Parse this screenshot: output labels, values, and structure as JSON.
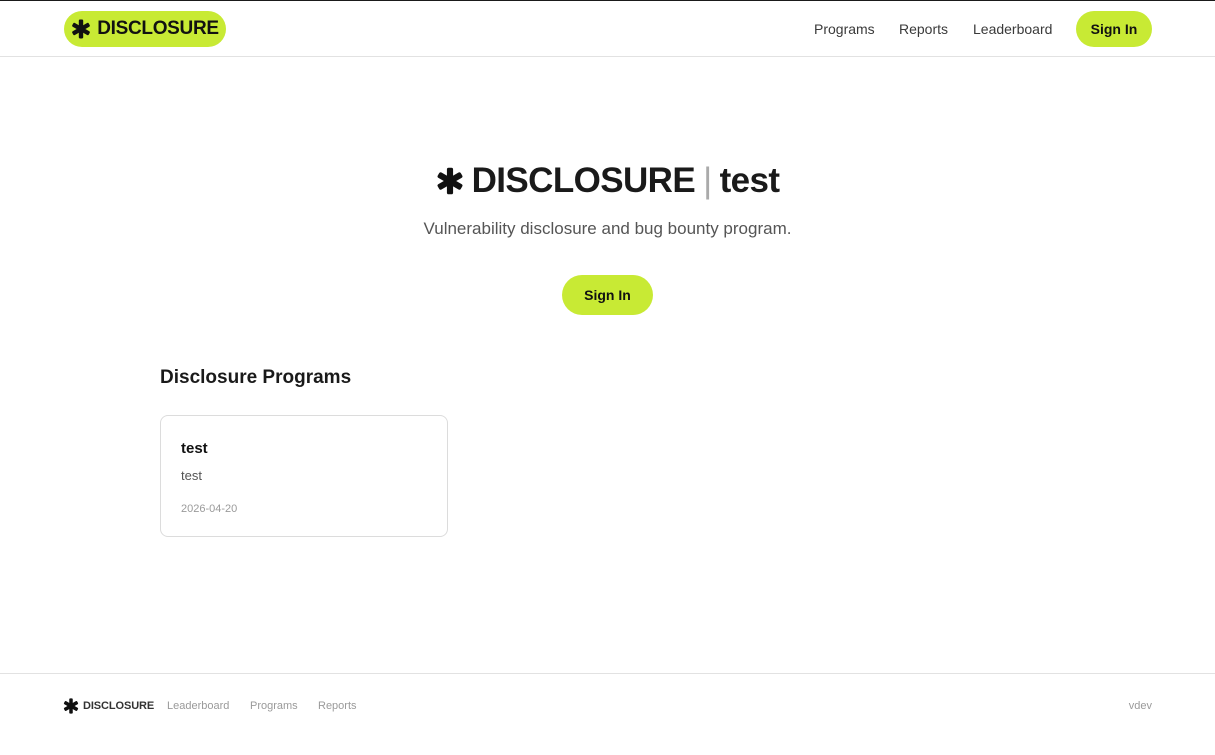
{
  "header": {
    "brand": "DISCLOSURE",
    "nav": {
      "programs": "Programs",
      "reports": "Reports",
      "leaderboard": "Leaderboard"
    },
    "sign_in": "Sign In"
  },
  "hero": {
    "brand": "DISCLOSURE",
    "separator": "|",
    "org": "test",
    "subtitle": "Vulnerability disclosure and bug bounty program.",
    "sign_in": "Sign In"
  },
  "programs": {
    "title": "Disclosure Programs",
    "items": [
      {
        "name": "test",
        "description": "test",
        "date": "2026-04-20"
      }
    ]
  },
  "footer": {
    "brand": "DISCLOSURE",
    "links": {
      "leaderboard": "Leaderboard",
      "programs": "Programs",
      "reports": "Reports"
    },
    "version": "vdev"
  },
  "colors": {
    "accent": "#c8ea34",
    "text": "#1a1a1a",
    "muted": "#9a9a9a"
  }
}
